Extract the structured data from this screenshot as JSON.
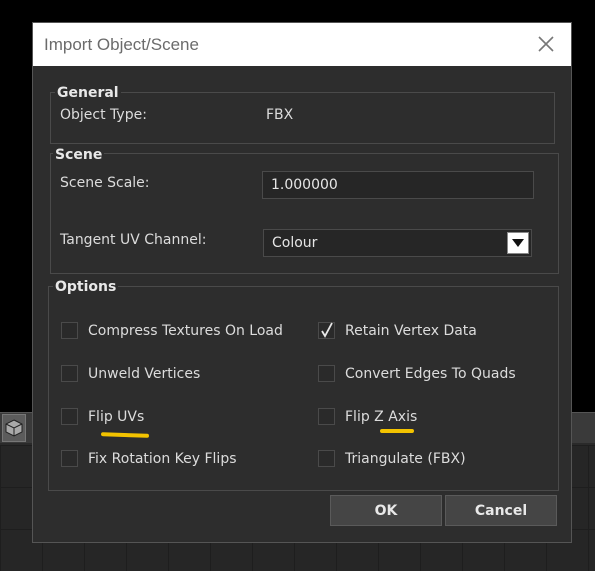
{
  "dialog": {
    "title": "Import Object/Scene",
    "close_icon": "close-icon"
  },
  "general": {
    "legend": "General",
    "object_type_label": "Object Type:",
    "object_type_value": "FBX"
  },
  "scene": {
    "legend": "Scene",
    "scale_label": "Scene Scale:",
    "scale_value": "1.000000",
    "tangent_label": "Tangent UV Channel:",
    "tangent_value": "Colour",
    "dropdown_icon": "chevron-down-icon"
  },
  "options": {
    "legend": "Options",
    "items": [
      {
        "label": "Compress Textures On Load",
        "checked": false
      },
      {
        "label": "Retain Vertex Data",
        "checked": true
      },
      {
        "label": "Unweld Vertices",
        "checked": false
      },
      {
        "label": "Convert Edges To Quads",
        "checked": false
      },
      {
        "label": "Flip UVs",
        "checked": false
      },
      {
        "label": "Flip Z Axis",
        "checked": false
      },
      {
        "label": "Fix Rotation Key Flips",
        "checked": false
      },
      {
        "label": "Triangulate (FBX)",
        "checked": false
      }
    ]
  },
  "buttons": {
    "ok": "OK",
    "cancel": "Cancel"
  },
  "colors": {
    "dialog_bg": "#2d2d2d",
    "highlight": "#f3c300"
  }
}
